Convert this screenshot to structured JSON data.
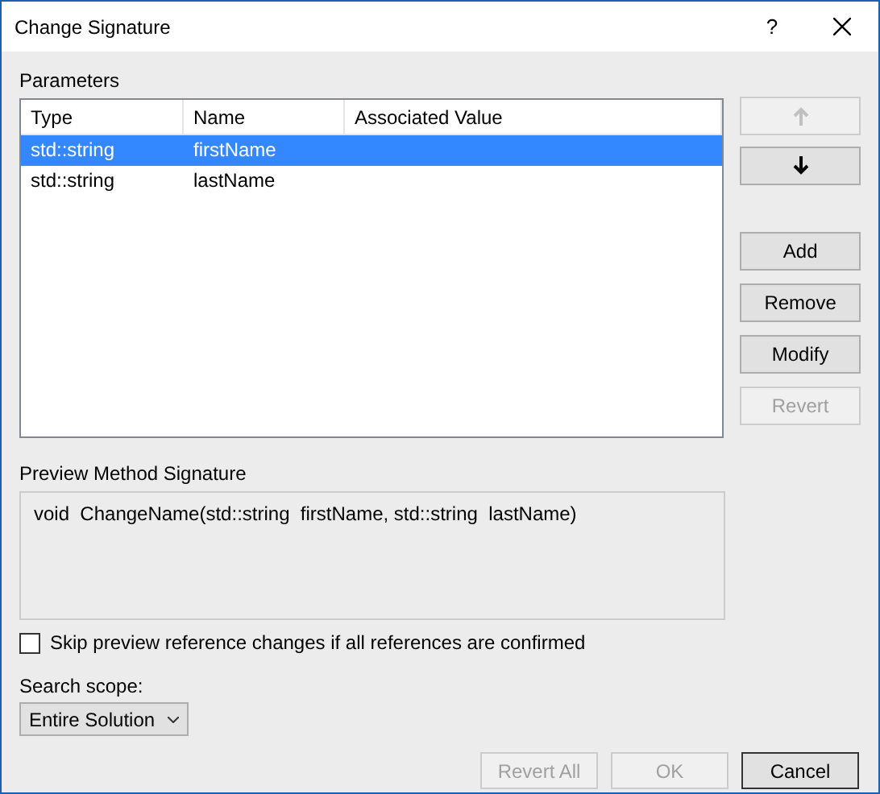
{
  "window": {
    "title": "Change Signature",
    "help": "?"
  },
  "parameters": {
    "label": "Parameters",
    "columns": [
      "Type",
      "Name",
      "Associated Value"
    ],
    "rows": [
      {
        "cells": [
          "std::string",
          "firstName",
          ""
        ],
        "selected": true
      },
      {
        "cells": [
          "std::string",
          "lastName",
          ""
        ],
        "selected": false
      }
    ]
  },
  "move_buttons": [
    {
      "kind": "up",
      "disabled": true
    },
    {
      "kind": "down",
      "disabled": false
    }
  ],
  "side_buttons": [
    {
      "label": "Add",
      "disabled": false
    },
    {
      "label": "Remove",
      "disabled": false
    },
    {
      "label": "Modify",
      "disabled": false
    },
    {
      "label": "Revert",
      "disabled": true
    }
  ],
  "preview": {
    "label": "Preview Method Signature",
    "text": "void  ChangeName(std::string  firstName, std::string  lastName)"
  },
  "skip_checkbox": {
    "label": "Skip preview reference changes if all references are confirmed",
    "checked": false
  },
  "search_scope": {
    "label": "Search scope:",
    "value": "Entire Solution"
  },
  "footer_buttons": [
    {
      "label": "Revert All",
      "disabled": true
    },
    {
      "label": "OK",
      "disabled": true
    },
    {
      "label": "Cancel",
      "disabled": false
    }
  ]
}
